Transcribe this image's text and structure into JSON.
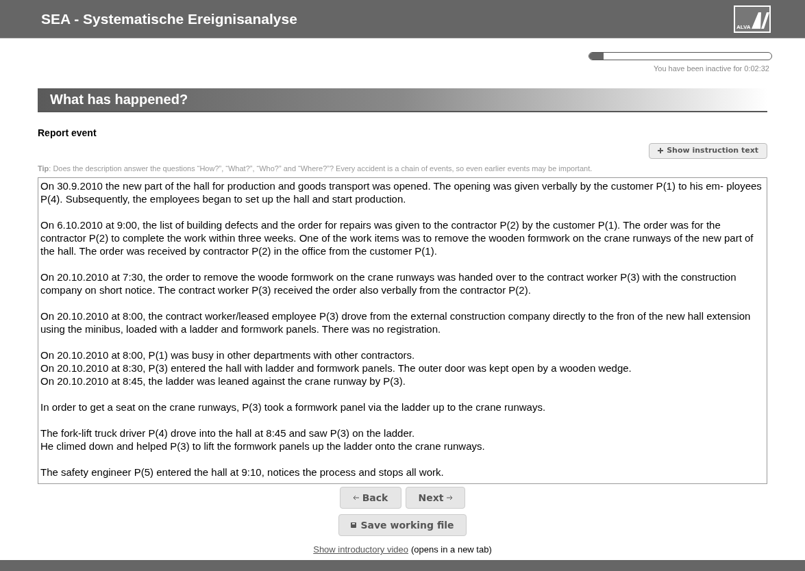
{
  "header": {
    "title": "SEA - Systematische Ereignisanalyse",
    "logo_text": "ALVA"
  },
  "inactivity": {
    "level": 0.08,
    "text": "You have been inactive for 0:02:32"
  },
  "section": {
    "title": "What has happened?"
  },
  "form": {
    "label": "Report event",
    "instruction_button": "Show instruction text",
    "tip_label": "Tip",
    "tip_text": ": Does the description answer the questions “How?”, “What?”, “Who?” and “Where?”? Every accident is a chain of events, so even earlier events may be important.",
    "paragraphs": [
      [
        "On 30.9.2010 the new part of the hall for production and goods transport was opened. The opening was given verbally by the customer P(1) to his em- ployees P(4). Subsequently, the employees began to set up the hall and start production."
      ],
      [
        "On 6.10.2010 at 9:00, the list of building defects and the order for repairs was given to the contractor P(2) by the customer P(1). The order was for the contractor P(2) to complete the work within three weeks. One of the work items was to remove the wooden formwork on the crane runways of the new part of the hall. The order was received by contractor P(2) in the office from the customer P(1)."
      ],
      [
        "On 20.10.2010 at 7:30, the order to remove the woode formwork on the crane runways was handed over to the contract worker P(3) with the construction company on short notice. The contract worker P(3) received the order also verbally from the contractor P(2)."
      ],
      [
        "On 20.10.2010 at 8:00, the contract worker/leased employee P(3) drove from the external construction company directly to the fron of the new hall extension using the minibus, loaded with a ladder and formwork panels. There was no registration."
      ],
      [
        "On 20.10.2010 at 8:00, P(1) was busy in other departments with other contractors.",
        "On 20.10.2010 at 8:30, P(3) entered the hall with ladder and formwork panels. The outer door was kept open by a wooden wedge.",
        "On 20.10.2010 at 8:45, the ladder was leaned against the crane runway by P(3)."
      ],
      [
        "In order to get a seat on the crane runways, P(3) took a formwork panel via the ladder up to the crane runways."
      ],
      [
        "The fork-lift truck driver P(4) drove into the hall at 8:45 and saw P(3) on the ladder.",
        "He climed down and helped P(3) to lift the formwork panels up the ladder onto the crane runways."
      ],
      [
        "The safety engineer P(5) entered the hall at 9:10, notices the process and stops all work."
      ]
    ]
  },
  "nav": {
    "back": "Back",
    "next": "Next",
    "save": "Save working file"
  },
  "footer_link": {
    "link": "Show introductory video",
    "note": "(opens in a new tab)"
  }
}
